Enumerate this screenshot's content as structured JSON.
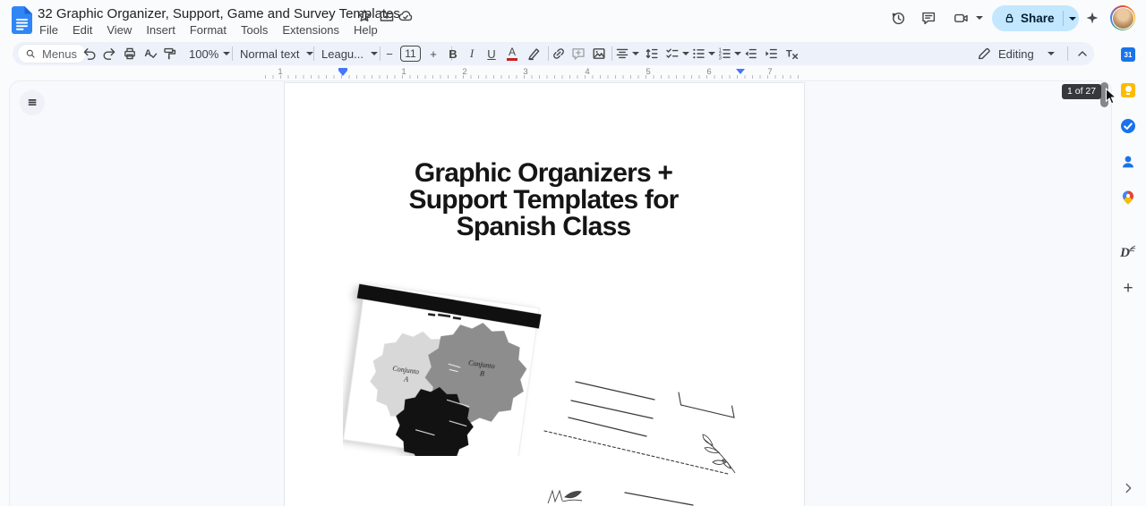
{
  "header": {
    "doc_title": "32 Graphic Organizer, Support, Game and Survey Templates",
    "menu_items": [
      "File",
      "Edit",
      "View",
      "Insert",
      "Format",
      "Tools",
      "Extensions",
      "Help"
    ],
    "share_label": "Share"
  },
  "toolbar": {
    "menus_label": "Menus",
    "zoom_value": "100%",
    "style_label": "Normal text",
    "font_label": "Leagu...",
    "font_size": "11",
    "minus_glyph": "−",
    "plus_glyph": "+",
    "bold_glyph": "B",
    "italic_glyph": "I",
    "underline_glyph": "U",
    "text_color_glyph": "A",
    "mode_label": "Editing"
  },
  "ruler": {
    "numbers": [
      "1",
      "1",
      "2",
      "3",
      "4",
      "5",
      "6",
      "7"
    ]
  },
  "doc": {
    "title_lines": [
      "Graphic Organizers +",
      "Support Templates for",
      "Spanish Class"
    ],
    "venn": {
      "a_label": [
        "Conjunto",
        "A"
      ],
      "b_label": [
        "Conjunto",
        "B"
      ]
    }
  },
  "scrollbar": {
    "page_indicator": "1 of 27"
  },
  "side_panel": {
    "calendar_day": "31",
    "addon_glyph": "D",
    "add_glyph": "+",
    "items": [
      "google-calendar",
      "google-keep",
      "google-tasks",
      "google-contacts",
      "google-maps",
      "docs-addon",
      "get-add-ons"
    ]
  },
  "colors": {
    "share_bg": "#c2e7ff",
    "toolbar_bg": "#edf2fa",
    "docs_blue": "#3086f6",
    "accent_blue": "#4577f6",
    "keep_yellow": "#fbbc04",
    "tasks_blue": "#1a73e8",
    "badge_bg": "#37383b"
  }
}
